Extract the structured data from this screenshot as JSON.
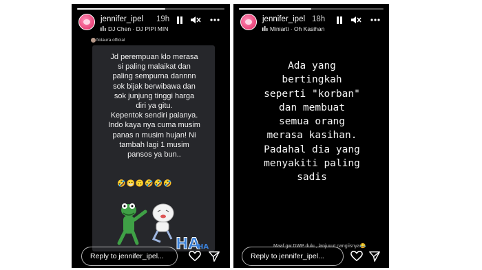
{
  "stories": [
    {
      "username": "jennifer_ipel",
      "time": "19h",
      "music": "DJ Chen · DJ PIPI MIN",
      "progress": 0.6,
      "repost_author": "fiolaura.official",
      "text": "Jd perempuan klo merasa\nsi paling malaikat dan\npaling sempurna dannnn\nsok bijak berwibawa dan\nsok junjung tinggi harga\ndiri ya gitu.\nKepentok sendiri palanya.\nIndo kaya nya cuma musim\npanas n musim hujan! Ni\ntambah lagi 1 musim\npansos ya bun..",
      "emojis": "🤣😁🙃🤣🤣🤣",
      "sticker_text": "HA",
      "sticker_text_small": "HA",
      "reply_placeholder": "Reply to jennifer_ipel..."
    },
    {
      "username": "jennifer_ipel",
      "time": "18h",
      "music": "Miniarti · Oh Kasihan",
      "progress": 0.5,
      "text": "Ada yang\nbertingkah\nseperti \"korban\"\ndan membuat\nsemua orang\nmerasa kasihan.\nPadahal dia yang\nmenyakiti paling\nsadis",
      "caption": "Maaf gw DWP dulu , lanjuuut nangiisnya😂",
      "reply_placeholder": "Reply to jennifer_ipel..."
    }
  ],
  "icons": {
    "pause": "pause-icon",
    "mute": "mute-icon",
    "more": "more-icon",
    "like": "heart-icon",
    "send": "send-icon",
    "music": "music-bars-icon"
  },
  "colors": {
    "background": "#000000",
    "card": "#26272b",
    "accent": "#e0245e"
  }
}
